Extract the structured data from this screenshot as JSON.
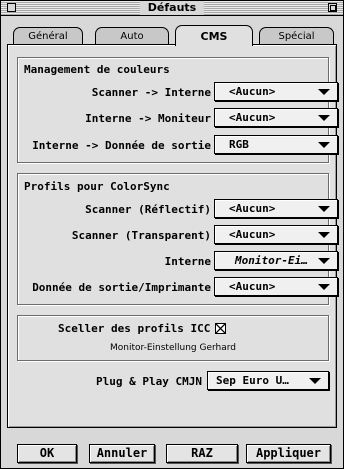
{
  "window": {
    "title": "Défauts"
  },
  "tabs": [
    {
      "label": "Général",
      "active": false
    },
    {
      "label": "Auto",
      "active": false
    },
    {
      "label": "CMS",
      "active": true
    },
    {
      "label": "Spécial",
      "active": false
    }
  ],
  "color_management": {
    "title": "Management de couleurs",
    "rows": [
      {
        "label": "Scanner -> Interne",
        "value": "<Aucun>"
      },
      {
        "label": "Interne -> Moniteur",
        "value": "<Aucun>"
      },
      {
        "label": "Interne -> Donnée de sortie",
        "value": "RGB"
      }
    ]
  },
  "colorsync": {
    "title": "Profils pour ColorSync",
    "rows": [
      {
        "label": "Scanner (Réflectif)",
        "value": "<Aucun>"
      },
      {
        "label": "Scanner (Transparent)",
        "value": "<Aucun>"
      },
      {
        "label": "Interne",
        "value": "Monitor-Ei…"
      },
      {
        "label": "Donnée de sortie/Imprimante",
        "value": "<Aucun>"
      }
    ]
  },
  "seal": {
    "label": "Sceller des profils ICC",
    "checked": true,
    "caption": "Monitor-Einstellung Gerhard"
  },
  "plug_play": {
    "label": "Plug & Play CMJN",
    "value": "Sep Euro U…"
  },
  "buttons": {
    "ok": "OK",
    "cancel": "Annuler",
    "reset": "RAZ",
    "apply": "Appliquer"
  }
}
